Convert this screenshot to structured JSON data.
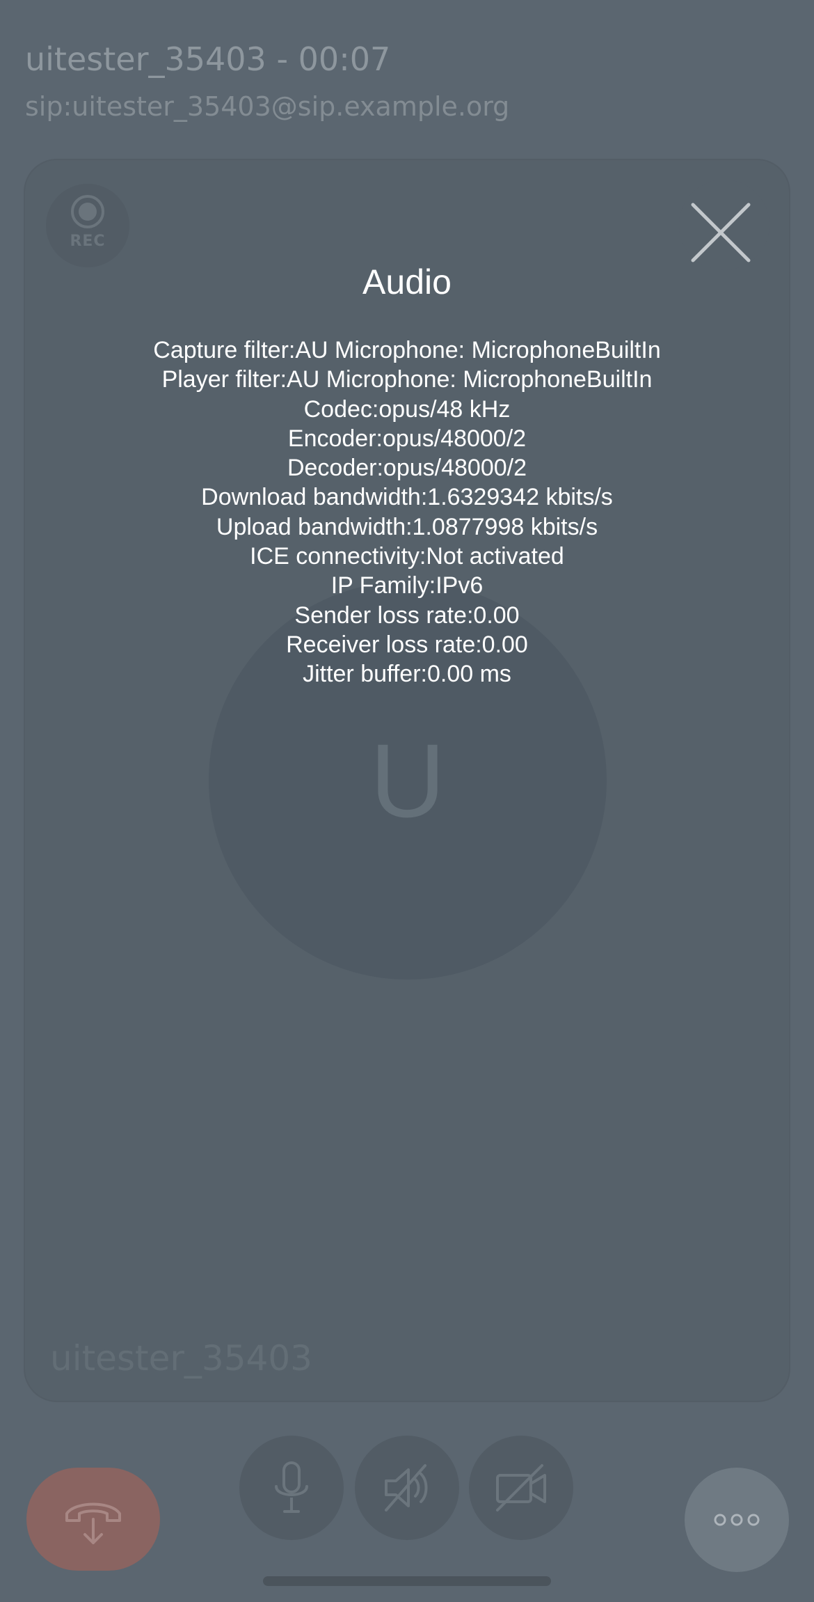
{
  "header": {
    "title": "uitester_35403 - 00:07",
    "sip_address": "sip:uitester_35403@sip.example.org"
  },
  "call_card": {
    "record_label": "REC",
    "avatar_initial": "U",
    "display_name": "uitester_35403"
  },
  "stats": {
    "title": "Audio",
    "lines": [
      "Capture filter:AU Microphone: MicrophoneBuiltIn",
      "Player filter:AU Microphone: MicrophoneBuiltIn",
      "Codec:opus/48 kHz",
      "Encoder:opus/48000/2",
      "Decoder:opus/48000/2",
      "Download bandwidth:1.6329342 kbits/s",
      "Upload bandwidth:1.0877998 kbits/s",
      "ICE connectivity:Not activated",
      "IP Family:IPv6",
      "Sender loss rate:0.00",
      "Receiver loss rate:0.00",
      "Jitter buffer:0.00 ms"
    ]
  },
  "icons": {
    "record": "record-icon",
    "close": "close-icon",
    "hangup": "hangup-icon",
    "microphone": "microphone-icon",
    "speaker_muted": "speaker-muted-icon",
    "camera_off": "camera-off-icon",
    "more": "more-options-icon"
  },
  "colors": {
    "background": "#5b6670",
    "hangup": "#8a6461",
    "text": "#ffffff"
  }
}
